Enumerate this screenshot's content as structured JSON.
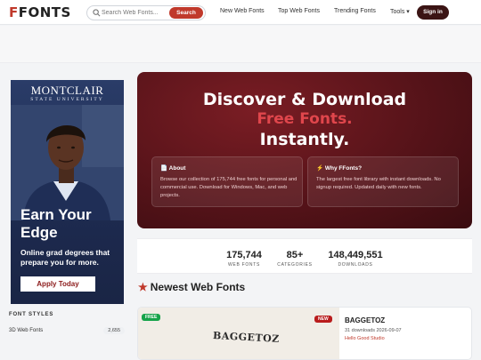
{
  "header": {
    "logo": "FFONTS",
    "search_placeholder": "Search Web Fonts...",
    "search_button": "Search",
    "nav": [
      "New Web Fonts",
      "Top Web Fonts",
      "Trending Fonts",
      "Tools ▾"
    ],
    "signin": "Sign in"
  },
  "ad": {
    "school_name": "MONTCLAIR",
    "school_sub": "STATE UNIVERSITY",
    "headline_1": "Earn Your",
    "headline_2": "Edge",
    "subline_1": "Online grad degrees that",
    "subline_2": "prepare you for more.",
    "cta": "Apply Today"
  },
  "sidebar": {
    "heading": "FONT STYLES",
    "items": [
      {
        "label": "3D Web Fonts",
        "count": "2,655"
      },
      {
        "label": "",
        "count": ""
      }
    ]
  },
  "hero": {
    "title_1": "Discover & Download",
    "title_2": "Free Fonts.",
    "title_3": "Instantly.",
    "cards": [
      {
        "icon": "document-icon",
        "title": "📄 About",
        "body": "Browse our collection of 175,744 free fonts for personal and commercial use. Download for Windows, Mac, and web projects."
      },
      {
        "icon": "lightning-icon",
        "title": "⚡ Why FFonts?",
        "body": "The largest free font library with instant downloads. No signup required. Updated daily with new fonts."
      }
    ]
  },
  "stats": [
    {
      "value": "175,744",
      "label": "WEB FONTS"
    },
    {
      "value": "85+",
      "label": "CATEGORIES"
    },
    {
      "value": "148,449,551",
      "label": "DOWNLOADS"
    }
  ],
  "newest": {
    "star": "★",
    "heading": "Newest Web Fonts"
  },
  "font_card": {
    "free_badge": "FREE",
    "new_badge": "NEW",
    "preview_text": "BAGGETOZ",
    "name": "BAGGETOZ",
    "meta": "31 downloads  2026-09-07",
    "studio": "Hello Good Studio"
  },
  "colors": {
    "accent": "#c0392b",
    "hero_bg": "#561319",
    "signin_bg": "#3b1414"
  }
}
